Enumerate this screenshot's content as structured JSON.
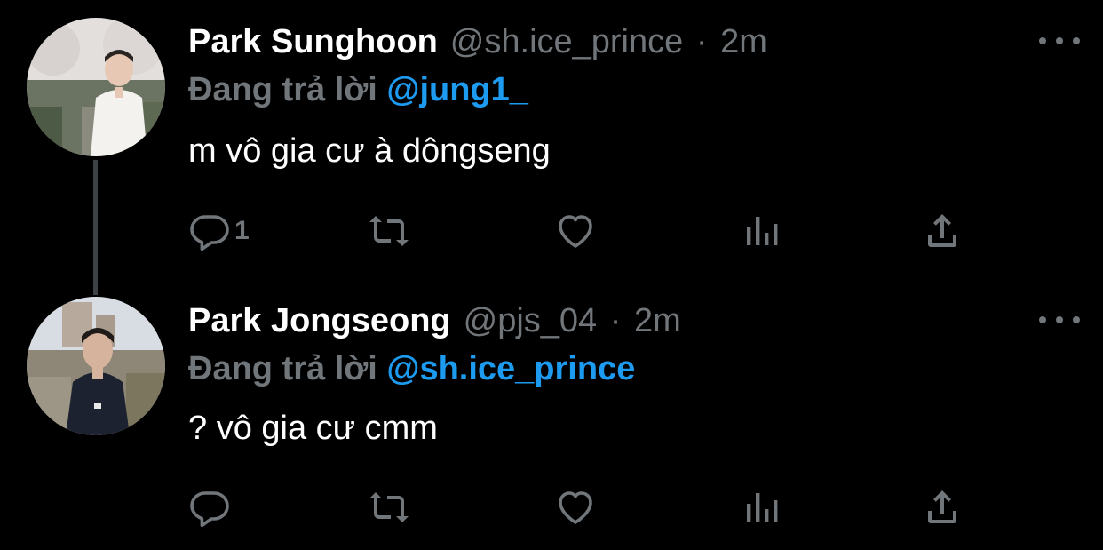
{
  "thread": {
    "tweets": [
      {
        "display_name": "Park Sunghoon",
        "handle": "@sh.ice_prince",
        "separator": "·",
        "time": "2m",
        "reply_prefix": "Đang trả lời",
        "reply_to": "@jung1_",
        "text": "m vô gia cư à dôngseng",
        "reply_count": "1",
        "avatar_icon": "user-photo-avatar"
      },
      {
        "display_name": "Park Jongseong",
        "handle": "@pjs_04",
        "separator": "·",
        "time": "2m",
        "reply_prefix": "Đang trả lời",
        "reply_to": "@sh.ice_prince",
        "text": "? vô gia cư cmm",
        "reply_count": "",
        "avatar_icon": "user-photo-avatar"
      }
    ]
  },
  "icons": {
    "reply": "reply-icon",
    "retweet": "retweet-icon",
    "like": "heart-icon",
    "stats": "analytics-icon",
    "share": "share-icon",
    "more": "more-options-icon"
  },
  "colors": {
    "background": "#000000",
    "primary_text": "#ffffff",
    "secondary_text": "#71767b",
    "link": "#1d9bf0",
    "thread_line": "#3e4144"
  }
}
